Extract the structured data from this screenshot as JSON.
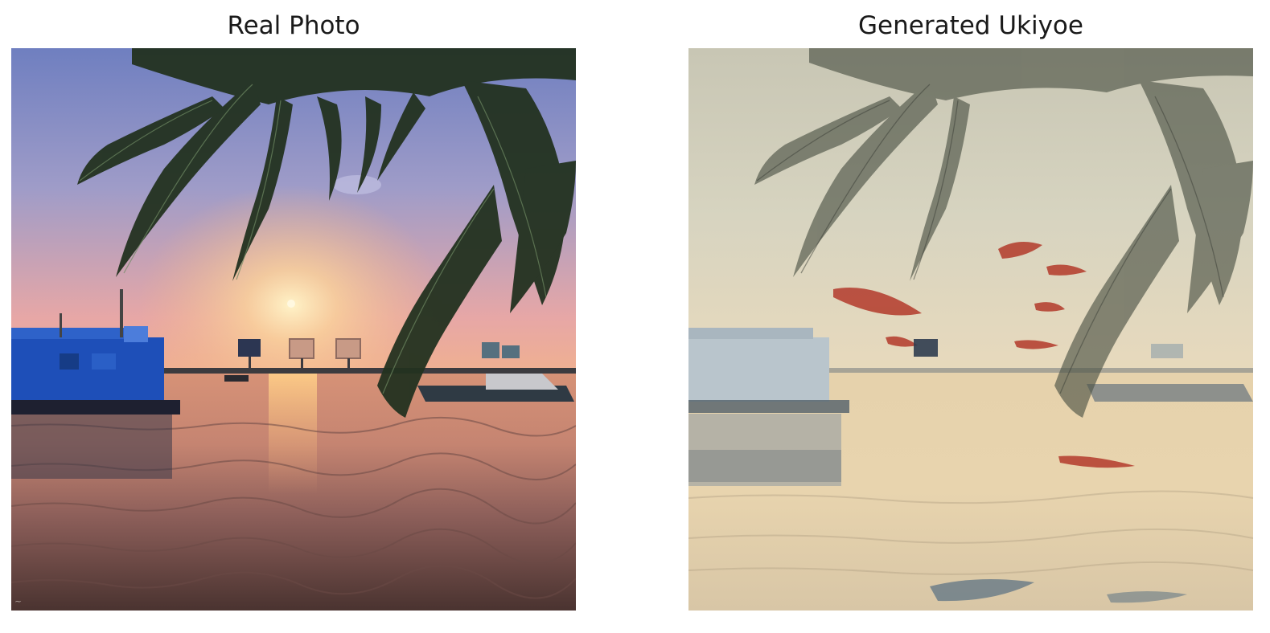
{
  "figure": {
    "panels": [
      {
        "title": "Real Photo"
      },
      {
        "title": "Generated Ukiyoe"
      }
    ]
  }
}
